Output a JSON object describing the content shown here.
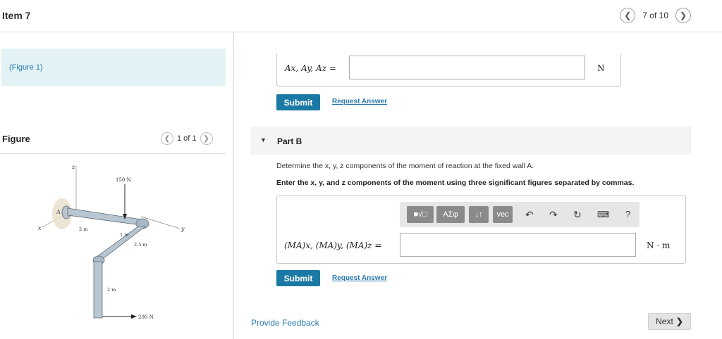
{
  "header": {
    "title": "Item 7",
    "pager_text": "7 of 10",
    "prev_icon": "chevron-left-icon",
    "next_icon": "chevron-right-icon"
  },
  "figure_panel": {
    "figure_link": "(Figure 1)",
    "heading": "Figure",
    "pager_text": "1 of 1",
    "labels": {
      "z": "z",
      "x": "x",
      "y": "y",
      "A": "A",
      "force_top": "150 N",
      "force_bottom": "200 N",
      "dim_2m_a": "2 m",
      "dim_1m": "1 m",
      "dim_25m": "2.5 m",
      "dim_2m_b": "2 m"
    }
  },
  "part_a": {
    "answer_label": "Ax, Ay, Az =",
    "input_value": "",
    "unit": "N",
    "submit_label": "Submit",
    "request_label": "Request Answer"
  },
  "part_b": {
    "title": "Part B",
    "prompt1": "Determine the x, y, z components of the moment of reaction at the fixed wall A.",
    "prompt2": "Enter the x, y, and z components of the moment using three significant figures separated by commas.",
    "toolbar": {
      "templates_icon": "templates-icon",
      "greek_label": "ΑΣφ",
      "arrows_label": "↓↑",
      "vec_label": "vec",
      "undo_icon": "undo-icon",
      "redo_icon": "redo-icon",
      "reset_icon": "reset-icon",
      "keyboard_icon": "keyboard-icon",
      "help_label": "?"
    },
    "answer_label": "(MA)x, (MA)y, (MA)z =",
    "input_value": "",
    "unit": "N · m",
    "submit_label": "Submit",
    "request_label": "Request Answer"
  },
  "footer": {
    "feedback_label": "Provide Feedback",
    "next_label": "Next"
  },
  "colors": {
    "accent": "#1b7aa5",
    "link": "#2a7ab0",
    "figure_link_bg": "#e2f2f5"
  }
}
